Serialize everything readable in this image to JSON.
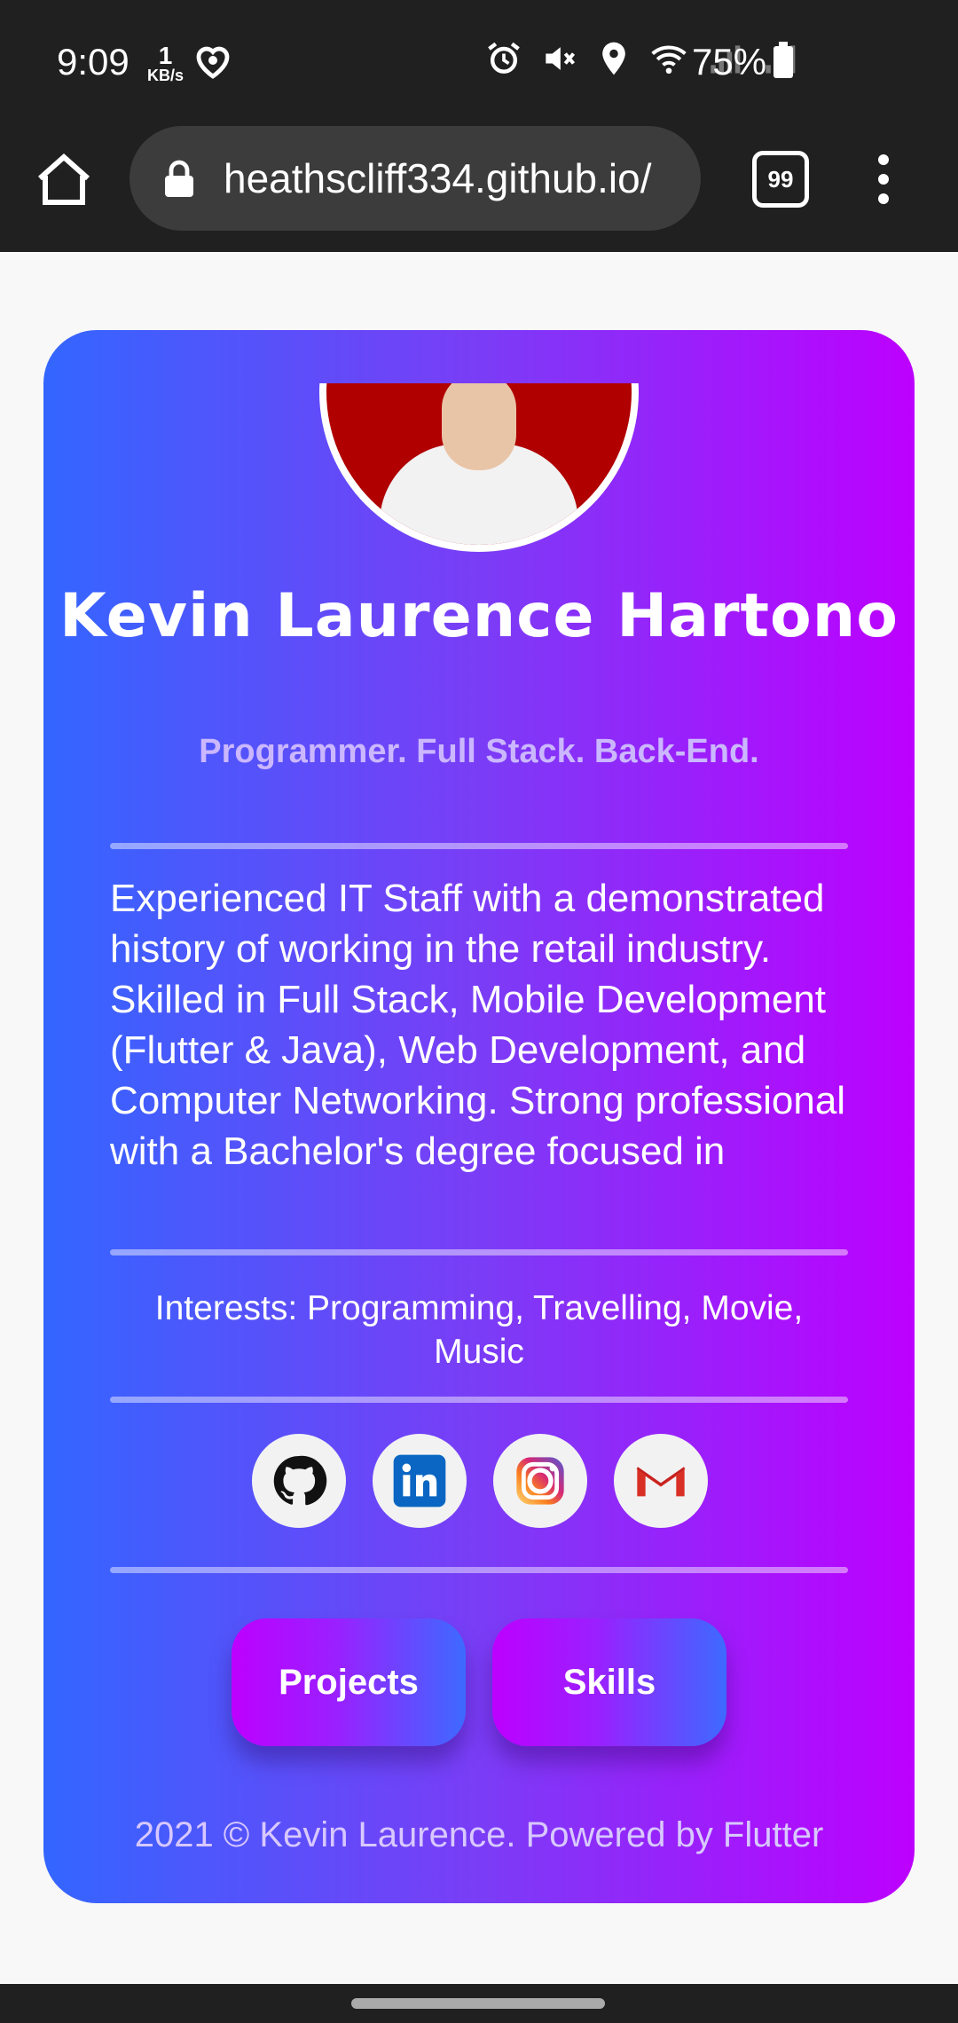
{
  "status_bar": {
    "time": "9:09",
    "net_speed_value": "1",
    "net_speed_unit": "KB/s",
    "battery": "75%",
    "icons": [
      "heart-icon",
      "alarm-icon",
      "mute-icon",
      "location-icon",
      "wifi-icon",
      "signal-icon",
      "signal-icon",
      "battery-icon"
    ]
  },
  "browser": {
    "url": "heathscliff334.github.io/",
    "tab_count": "99"
  },
  "profile": {
    "name": "Kevin Laurence Hartono",
    "tagline": "Programmer. Full Stack. Back-End.",
    "bio": "Experienced IT Staff with a demonstrated history of working in the retail industry. Skilled in Full Stack, Mobile Development (Flutter & Java), Web Development, and Computer Networking. Strong professional with a Bachelor's degree focused in",
    "interests": "Interests: Programming, Travelling, Movie, Music"
  },
  "social": [
    {
      "name": "github-icon"
    },
    {
      "name": "linkedin-icon"
    },
    {
      "name": "instagram-icon"
    },
    {
      "name": "gmail-icon"
    }
  ],
  "buttons": {
    "projects": "Projects",
    "skills": "Skills"
  },
  "footer": "2021 © Kevin Laurence. Powered by Flutter",
  "colors": {
    "gradient_start": "#3366ff",
    "gradient_end": "#bd00ff",
    "chrome_bg": "#202020"
  }
}
